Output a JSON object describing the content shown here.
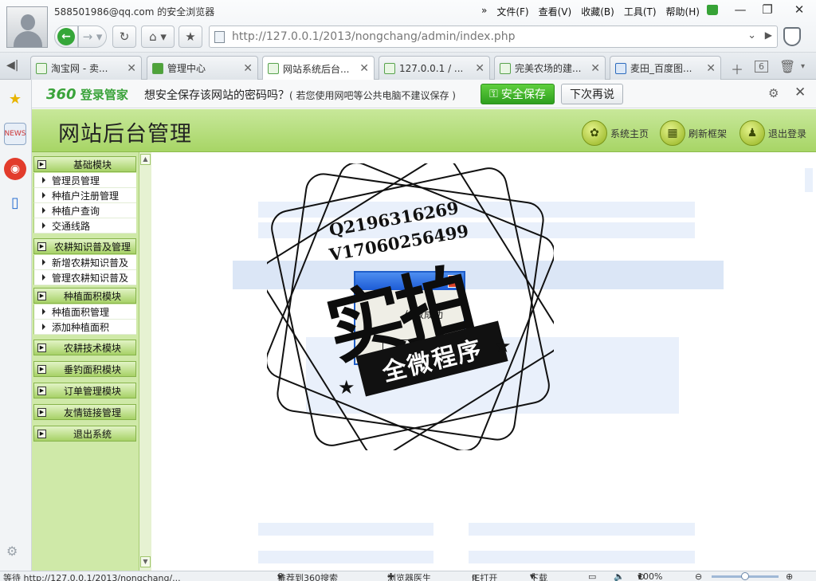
{
  "browser": {
    "user_email_text": "588501986@qq.com 的安全浏览器",
    "menu_arrow": "»",
    "menu": [
      "文件(F)",
      "查看(V)",
      "收藏(B)",
      "工具(T)",
      "帮助(H)"
    ],
    "window_controls": [
      "—",
      "❐",
      "✕"
    ],
    "address_url": "http://127.0.0.1/2013/nongchang/admin/index.php",
    "tabs": [
      {
        "label": "淘宝网 - 卖...",
        "icon": "page-green-icon"
      },
      {
        "label": "管理中心",
        "icon": "360-icon"
      },
      {
        "label": "网站系统后台...",
        "icon": "page-green-icon",
        "active": true
      },
      {
        "label": "127.0.0.1 / ...",
        "icon": "page-green-icon"
      },
      {
        "label": "完美农场的建...",
        "icon": "page-green-icon"
      },
      {
        "label": "麦田_百度图...",
        "icon": "baidu-paw-icon"
      }
    ],
    "tab_count": "6"
  },
  "password_bar": {
    "logo_prefix": "360",
    "logo_suffix": "登录管家",
    "message": "想安全保存该网站的密码吗？",
    "note": "( 若您使用网吧等公共电脑不建议保存 )",
    "save_button": "安全保存",
    "later_button": "下次再说"
  },
  "app": {
    "title": "网站后台管理",
    "header_buttons": [
      "系统主页",
      "刷新框架",
      "退出登录"
    ],
    "nav": [
      {
        "section": "基础模块",
        "items": [
          "管理员管理",
          "种植户注册管理",
          "种植户查询",
          "交通线路"
        ]
      },
      {
        "section": "农耕知识普及管理",
        "items": [
          "新增农耕知识普及",
          "管理农耕知识普及"
        ]
      },
      {
        "section": "种植面积模块",
        "items": [
          "种植面积管理",
          "添加种植面积"
        ]
      },
      {
        "section": "农耕技术模块",
        "items": []
      },
      {
        "section": "垂钓面积模块",
        "items": []
      },
      {
        "section": "订单管理模块",
        "items": []
      },
      {
        "section": "友情链接管理",
        "items": []
      },
      {
        "section": "退出系统",
        "items": []
      }
    ]
  },
  "watermark": {
    "qq": "Q2196316269",
    "wechat": "V17060256499",
    "big": "实拍",
    "banner": "全微程序"
  },
  "dialog": {
    "message": "修改成功",
    "ok_button": "确定"
  },
  "statusbar": {
    "loading": "等待 http://127.0.0.1/2013/nongchang/...",
    "recommend": "推荐到360搜索",
    "doctor": "浏览器医生",
    "ie": "IE打开",
    "download": "下载",
    "zoom": "100%"
  },
  "colors": {
    "nav_green": "#a7d167",
    "header_green": "#b8df80",
    "save_green": "#3cad27",
    "dialog_blue": "#1f5ec9"
  }
}
